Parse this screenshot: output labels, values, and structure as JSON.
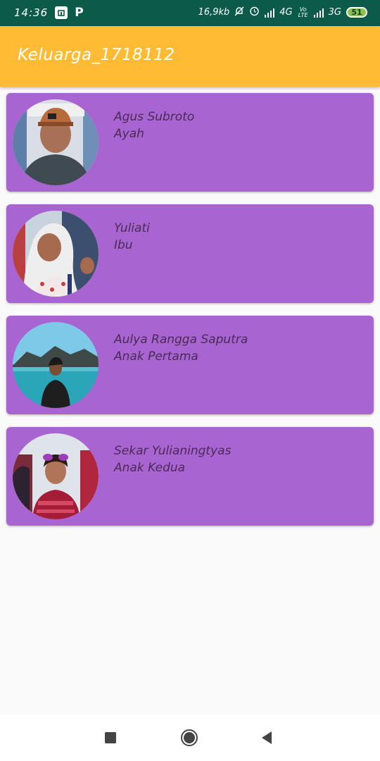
{
  "status_bar": {
    "time": "14:36",
    "notification_icons": [
      "mi-icon",
      "p-icon"
    ],
    "p_label": "P",
    "data_speed": "16,9kb",
    "network_1": "4G",
    "volte": "Vo LTE",
    "network_2": "3G",
    "battery": "51",
    "background_color": "#0b5a4a"
  },
  "app_bar": {
    "title": "Keluarga_1718112",
    "background_color": "#ffbb33"
  },
  "family": [
    {
      "name": "Agus Subroto",
      "role": "Ayah"
    },
    {
      "name": "Yuliati",
      "role": "Ibu"
    },
    {
      "name": "Aulya Rangga Saputra",
      "role": "Anak Pertama"
    },
    {
      "name": "Sekar Yulianingtyas",
      "role": "Anak Kedua"
    }
  ],
  "card_color": "#a865d1",
  "nav_bar": {
    "buttons": [
      "recent-apps-icon",
      "home-icon",
      "back-icon"
    ]
  }
}
